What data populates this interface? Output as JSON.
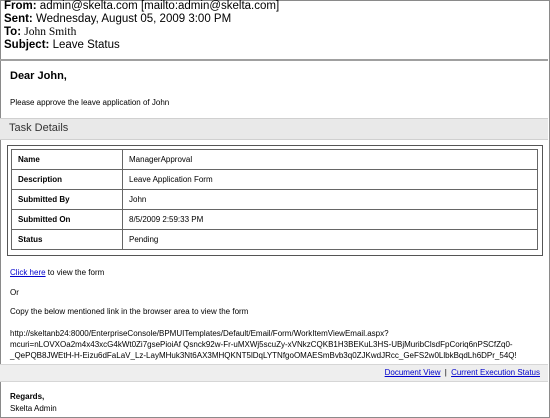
{
  "header": {
    "from_label": "From:",
    "from_value": "admin@skelta.com [mailto:admin@skelta.com]",
    "sent_label": "Sent:",
    "sent_value": "Wednesday, August 05, 2009 3:00 PM",
    "to_label": "To:",
    "to_value": "John Smith",
    "subject_label": "Subject:",
    "subject_value": "Leave Status"
  },
  "body": {
    "greeting": "Dear John,",
    "intro": "Please approve the leave application of John",
    "task_heading": "Task Details",
    "task_rows": [
      {
        "key": "Name",
        "value": "ManagerApproval"
      },
      {
        "key": "Description",
        "value": "Leave Application Form"
      },
      {
        "key": "Submitted By",
        "value": "John"
      },
      {
        "key": "Submitted On",
        "value": "8/5/2009 2:59:33 PM"
      },
      {
        "key": "Status",
        "value": "Pending"
      }
    ],
    "click_here": "Click here",
    "click_here_rest": " to view the form",
    "or_text": "Or",
    "copy_text": "Copy the below mentioned link in the browser area to view the form",
    "url_line1": "http://skeltanb24:8000/EnterpriseConsole/BPMUITemplates/Default/Email/Form/WorkItemViewEmail.aspx?",
    "url_line2": "mcuri=nLOVXOa2m4x43xcG4kWt0Zi7gsePioiAf Qsnck92w-Fr-uMXWj5scuZy-xVNkzCQKB1H3BEKuL3HS-UBjMuribClsdFpCoriq6nPSCfZq0-",
    "url_line3": "_QePQB8JWEtH-H-Eizu6dFaLaV_Lz-LayMHuk3Nt6AX3MHQKNT5lDqLYTNfgoOMAESmBvb3q0ZJKwdJRcc_GeFS2w0LlbkBqdLh6DPr_54Q!",
    "document_view": "Document View",
    "link_separator": "|",
    "execution_status": "Current Execution Status",
    "regards": "Regards,",
    "signature": "Skelta Admin"
  }
}
